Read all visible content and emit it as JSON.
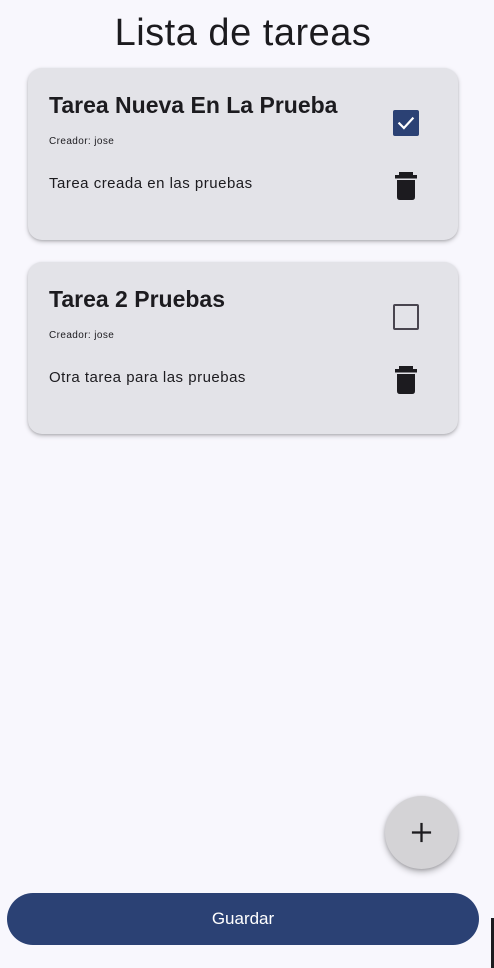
{
  "page": {
    "title": "Lista de tareas"
  },
  "creator_prefix": "Creador: ",
  "tasks": [
    {
      "title": "Tarea Nueva En La Prueba",
      "creator": "jose",
      "description": "Tarea creada en las pruebas",
      "completed": true
    },
    {
      "title": "Tarea 2 Pruebas",
      "creator": "jose",
      "description": "Otra tarea para las pruebas",
      "completed": false
    }
  ],
  "icons": {
    "checkbox_checked": "check-icon",
    "checkbox_unchecked": "empty-checkbox",
    "delete": "trash-icon",
    "add": "plus-icon"
  },
  "fab": {
    "icon": "plus-icon"
  },
  "footer": {
    "save_label": "Guardar"
  },
  "colors": {
    "primary": "#2b4174",
    "background": "#f8f7fd",
    "card": "#e3e3e8",
    "fab": "#d4d3d6"
  }
}
